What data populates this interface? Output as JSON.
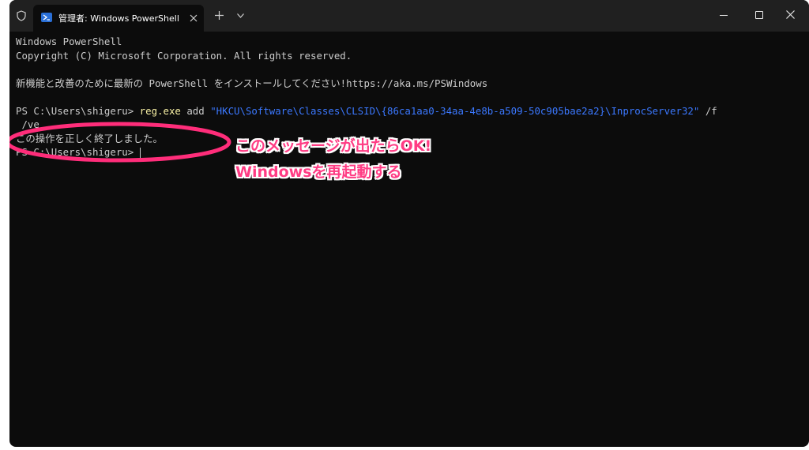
{
  "titlebar": {
    "tab_title": "管理者: Windows PowerShell"
  },
  "terminal": {
    "lines": {
      "l1": "Windows PowerShell",
      "l2": "Copyright (C) Microsoft Corporation. All rights reserved.",
      "l3": "新機能と改善のために最新の PowerShell をインストールしてください!https://aka.ms/PSWindows",
      "prompt1": "PS C:\\Users\\shigeru> ",
      "cmd": "reg.exe",
      "arg1": " add ",
      "regpath": "\"HKCU\\Software\\Classes\\CLSID\\{86ca1aa0-34aa-4e8b-a509-50c905bae2a2}\\InprocServer32\"",
      "flag_part1": " /f",
      "flag_part2": " /ve",
      "result": "この操作を正しく終了しました。",
      "prompt2": "PS C:\\Users\\shigeru> "
    }
  },
  "annotation": {
    "line1": "このメッセージが出たらOK!",
    "line2": "Windowsを再起動する",
    "color": "#ff3c84"
  }
}
